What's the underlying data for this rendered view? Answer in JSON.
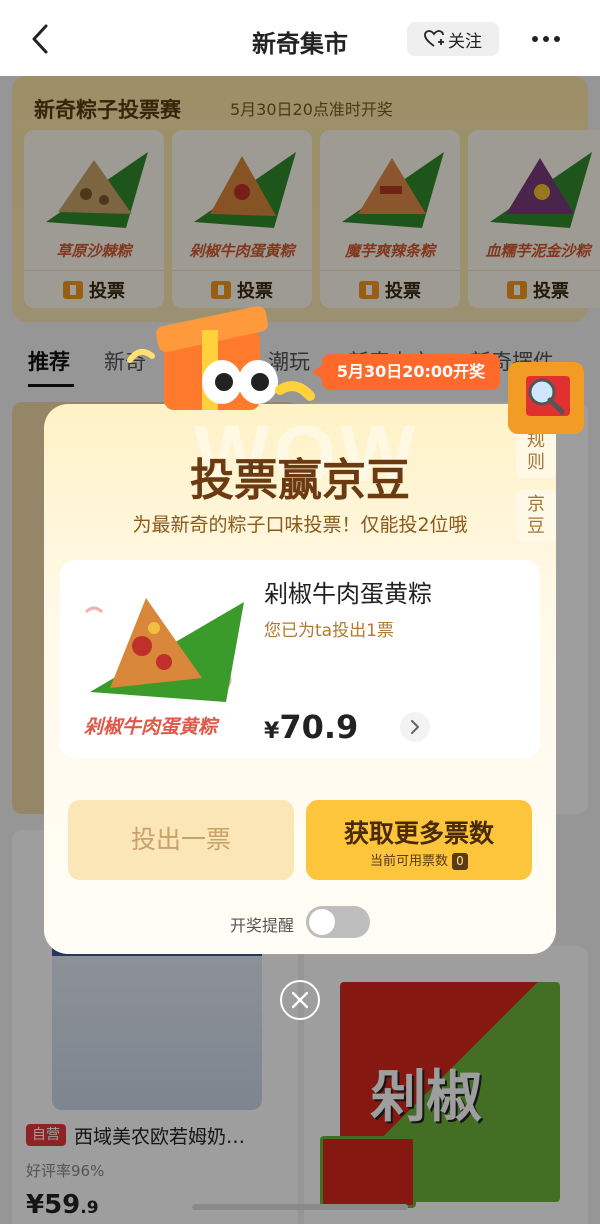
{
  "nav": {
    "title": "新奇集市",
    "follow_label": "关注",
    "icons": {
      "back": "chevron-left-icon",
      "follow": "heart-plus-icon",
      "more": "more-dots-icon"
    }
  },
  "banner": {
    "title": "新奇粽子投票赛",
    "subtitle": "5月30日20点准时开奖",
    "vote_label": "投票",
    "cards": [
      {
        "name": "草原沙棘粽"
      },
      {
        "name": "剁椒牛肉蛋黄粽"
      },
      {
        "name": "魔芋爽辣条粽"
      },
      {
        "name": "血糯芋泥金沙粽"
      }
    ]
  },
  "tabs": [
    {
      "label": "推荐"
    },
    {
      "label": "新奇"
    },
    {
      "label": "潮玩"
    },
    {
      "label": "新奇上市"
    },
    {
      "label": "新奇摆件"
    }
  ],
  "background_products": [
    {
      "tag": "自营",
      "name": "西域美农欧若姆奶…",
      "rate": "好评率96%",
      "price": "¥59",
      "price_decimal": ".9"
    }
  ],
  "popup": {
    "date_badge": "5月30日20:00开奖",
    "title": "投票赢京豆",
    "subtitle": "为最新奇的粽子口味投票！仅能投2位哦",
    "side_tabs": [
      "规则",
      "京豆"
    ],
    "product": {
      "image_label": "剁椒牛肉蛋黄粽",
      "name": "剁椒牛肉蛋黄粽",
      "votes_text": "您已为ta投出1票",
      "currency": "¥",
      "price": "70.9"
    },
    "cast_button": "投出一票",
    "more_button": "获取更多票数",
    "more_button_sub": "当前可用票数",
    "available_votes": "0",
    "reminder_label": "开奖提醒",
    "reminder_on": false,
    "wow_text": "WOW"
  },
  "colors": {
    "accent": "#fcc53c",
    "title_brown": "#6b3a10",
    "badge_orange": "#ff6a2c",
    "tag_red": "#e4393c"
  }
}
